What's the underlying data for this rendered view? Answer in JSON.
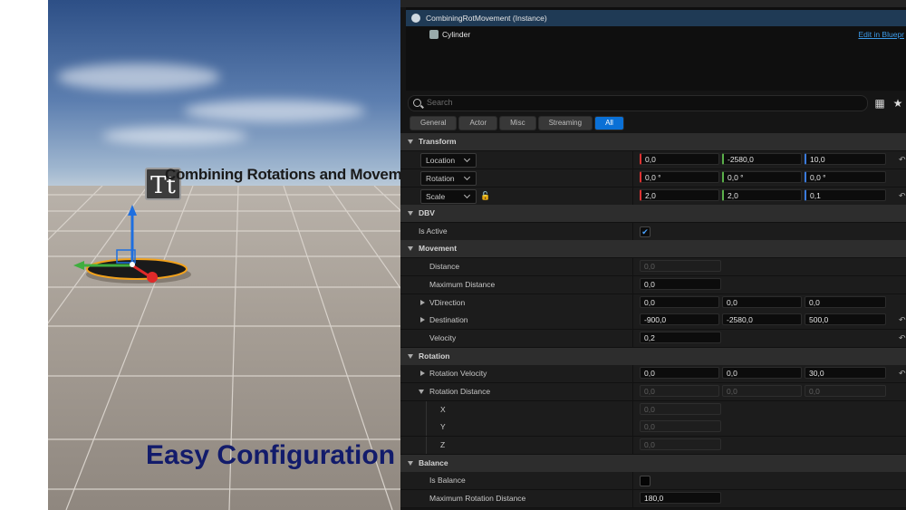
{
  "viewport": {
    "title": "Combining Rotations and Movement",
    "caption": "Easy Configuration",
    "text_icon": "Tt"
  },
  "tree": {
    "root_label": "CombiningRotMovement (Instance)",
    "child_label": "Cylinder",
    "edit_link": "Edit in Bluepr"
  },
  "search": {
    "placeholder": "Search"
  },
  "tabs": [
    "General",
    "Actor",
    "Misc",
    "Streaming",
    "All"
  ],
  "active_tab": "All",
  "details": {
    "transform": {
      "header": "Transform",
      "location": {
        "label": "Location",
        "x": "0,0",
        "y": "-2580,0",
        "z": "10,0"
      },
      "rotation": {
        "label": "Rotation",
        "x": "0,0 °",
        "y": "0,0 °",
        "z": "0,0 °"
      },
      "scale": {
        "label": "Scale",
        "x": "2,0",
        "y": "2,0",
        "z": "0,1"
      }
    },
    "dbv": {
      "header": "DBV",
      "is_active": "Is Active",
      "is_active_checked": true
    },
    "movement": {
      "header": "Movement",
      "distance": {
        "label": "Distance",
        "value": "0,0"
      },
      "max_distance": {
        "label": "Maximum Distance",
        "value": "0,0"
      },
      "vdirection": {
        "label": "VDirection",
        "x": "0,0",
        "y": "0,0",
        "z": "0,0"
      },
      "destination": {
        "label": "Destination",
        "x": "-900,0",
        "y": "-2580,0",
        "z": "500,0"
      },
      "velocity": {
        "label": "Velocity",
        "value": "0,2"
      }
    },
    "rotation": {
      "header": "Rotation",
      "rot_velocity": {
        "label": "Rotation Velocity",
        "x": "0,0",
        "y": "0,0",
        "z": "30,0"
      },
      "rot_distance": {
        "label": "Rotation Distance",
        "x": "0,0",
        "y": "0,0",
        "z": "0,0"
      },
      "x": {
        "label": "X",
        "value": "0,0"
      },
      "y": {
        "label": "Y",
        "value": "0,0"
      },
      "z": {
        "label": "Z",
        "value": "0,0"
      }
    },
    "balance": {
      "header": "Balance",
      "is_balance": "Is Balance",
      "is_balance_checked": false,
      "max_rot_distance": {
        "label": "Maximum Rotation Distance",
        "value": "180,0"
      }
    }
  },
  "colors": {
    "accent": "#0a70d6",
    "selection": "#1f3a55",
    "caption": "#121b6b"
  },
  "icons": [
    "text-render-icon",
    "search-icon",
    "table-view-icon",
    "star-icon",
    "lock-icon",
    "reset-arrow-icon",
    "component-icon",
    "mesh-icon"
  ]
}
